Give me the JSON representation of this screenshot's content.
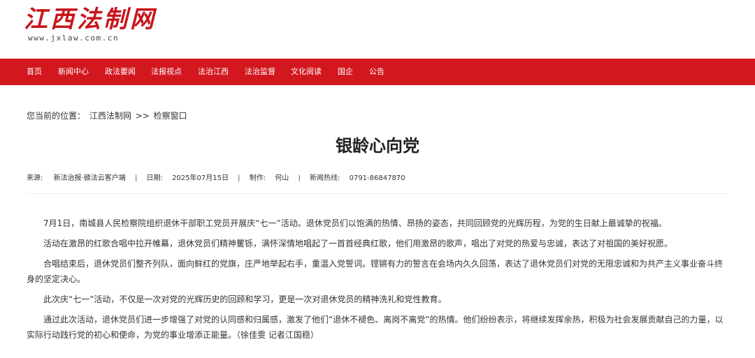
{
  "site": {
    "name": "江西法制网",
    "url": "www.jxlaw.com.cn"
  },
  "nav": {
    "items": [
      "首页",
      "新闻中心",
      "政法要闻",
      "法报视点",
      "法治江西",
      "法治监督",
      "文化阅读",
      "国企",
      "公告"
    ]
  },
  "breadcrumb": {
    "prefix": "您当前的位置：",
    "home": "江西法制网",
    "separator": ">>",
    "current": "检察窗口"
  },
  "article": {
    "title": "银龄心向党",
    "meta": {
      "source_label": "来源:",
      "source": "新法治报·赣法云客户端",
      "date_label": "日期:",
      "date": "2025年07月15日",
      "author_label": "制作:",
      "author": "何山",
      "hotline_label": "新闻热线:",
      "hotline": "0791-86847870",
      "separator": "|"
    },
    "paragraphs": [
      "7月1日，南城县人民检察院组织退休干部职工党员开展庆“七一”活动。退休党员们以饱满的热情、昂扬的姿态，共同回顾党的光辉历程，为党的生日献上最诚挚的祝福。",
      "活动在激昂的红歌合唱中拉开帷幕，退休党员们精神矍铄，满怀深情地唱起了一首首经典红歌，他们用激昂的歌声，唱出了对党的热爱与忠诚，表达了对祖国的美好祝愿。",
      "合唱结束后，退休党员们整齐列队，面向鲜红的党旗，庄严地举起右手，重温入党誓词。铿锵有力的誓言在会场内久久回荡，表达了退休党员们对党的无限忠诚和为共产主义事业奋斗终身的坚定决心。",
      "此次庆“七一”活动，不仅是一次对党的光辉历史的回顾和学习，更是一次对退休党员的精神洗礼和党性教育。",
      "通过此次活动，退休党员们进一步增强了对党的认同感和归属感，激发了他们“退休不褪色、离岗不离党”的热情。他们纷纷表示，将继续发挥余热，积极为社会发展贡献自己的力量，以实际行动践行党的初心和使命，为党的事业增添正能量。（徐佳雯 记者江国稳）"
    ]
  },
  "colors": {
    "brand_red": "#d2171e",
    "logo_red": "#c8161d"
  }
}
